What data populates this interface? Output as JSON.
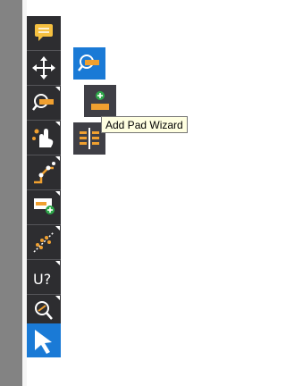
{
  "toolbar": {
    "tools": [
      {
        "icon": "comment-icon"
      },
      {
        "icon": "move-icon"
      },
      {
        "icon": "zoom-pad-icon"
      },
      {
        "icon": "touch-gesture-icon"
      },
      {
        "icon": "route-trace-icon"
      },
      {
        "icon": "add-pad-icon"
      },
      {
        "icon": "ratsnest-icon"
      },
      {
        "icon": "unrouted-query-icon",
        "label": "U?"
      },
      {
        "icon": "zoom-link-icon"
      },
      {
        "icon": "select-cursor-icon"
      }
    ]
  },
  "flyout": {
    "items": [
      {
        "icon": "zoom-pad-icon"
      },
      {
        "icon": "add-pad-wizard-icon"
      },
      {
        "icon": "pad-array-icon"
      }
    ]
  },
  "tooltip": {
    "text": "Add Pad Wizard"
  },
  "colors": {
    "toolbar_bg": "#2d2d30",
    "accent": "#1a7ad6",
    "orange": "#f0a030",
    "green": "#2ea84a"
  }
}
